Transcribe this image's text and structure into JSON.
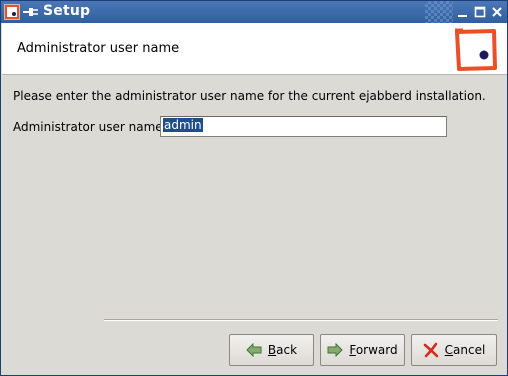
{
  "window": {
    "title": "Setup",
    "controls": {
      "minimize": "minimize",
      "maximize": "maximize",
      "close": "close"
    }
  },
  "header": {
    "title": "Administrator user name"
  },
  "main": {
    "intro": "Please enter the administrator user name for the current ejabberd installation.",
    "field_label": "Administrator user name",
    "field_value": "admin"
  },
  "buttons": {
    "back": {
      "mnemonic": "B",
      "rest": "ack"
    },
    "forward": {
      "mnemonic": "F",
      "rest": "orward"
    },
    "cancel": {
      "mnemonic": "C",
      "rest": "ancel"
    }
  },
  "colors": {
    "titlebar": "#305e9f",
    "logo_frame": "#e8502a",
    "logo_dot": "#1c1c5c",
    "selection": "#1f4e8c",
    "cancel_x": "#d8291f",
    "arrow_green": "#3d7a2a"
  },
  "icons": {
    "app": "app-icon",
    "plug": "plug-icon",
    "back": "arrow-left-icon",
    "forward": "arrow-right-icon",
    "cancel": "x-cancel-icon"
  }
}
